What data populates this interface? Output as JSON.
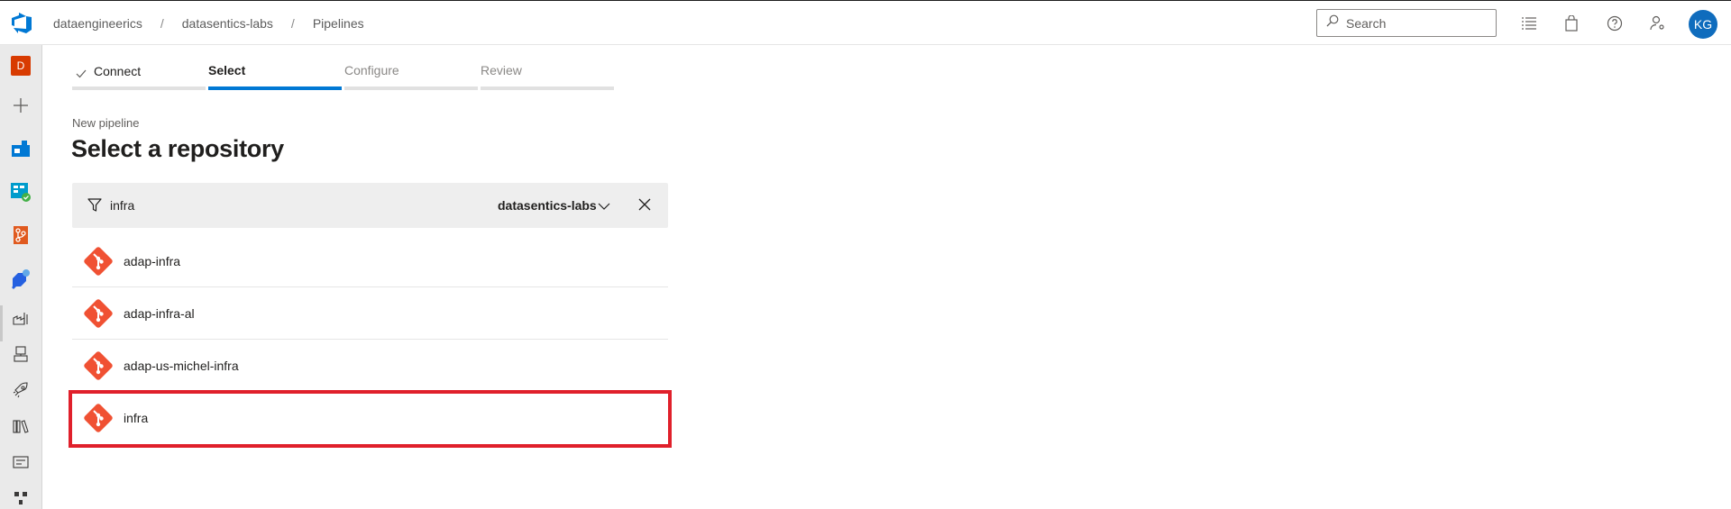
{
  "header": {
    "breadcrumb": [
      "dataengineerics",
      "datasentics-labs",
      "Pipelines"
    ],
    "search_placeholder": "Search",
    "avatar_initials": "KG"
  },
  "rail": {
    "org_letter": "D"
  },
  "wizard": {
    "steps": [
      {
        "label": "Connect",
        "state": "done"
      },
      {
        "label": "Select",
        "state": "active"
      },
      {
        "label": "Configure",
        "state": "pending"
      },
      {
        "label": "Review",
        "state": "pending"
      }
    ]
  },
  "page": {
    "subtitle": "New pipeline",
    "title": "Select a repository"
  },
  "filter": {
    "text": "infra",
    "organization": "datasentics-labs"
  },
  "repositories": [
    {
      "name": "adap-infra"
    },
    {
      "name": "adap-infra-al"
    },
    {
      "name": "adap-us-michel-infra"
    },
    {
      "name": "infra"
    }
  ],
  "colors": {
    "accent": "#0078d4",
    "git_icon": "#f05133",
    "highlight": "#e0202b",
    "org_badge": "#d83b01"
  }
}
